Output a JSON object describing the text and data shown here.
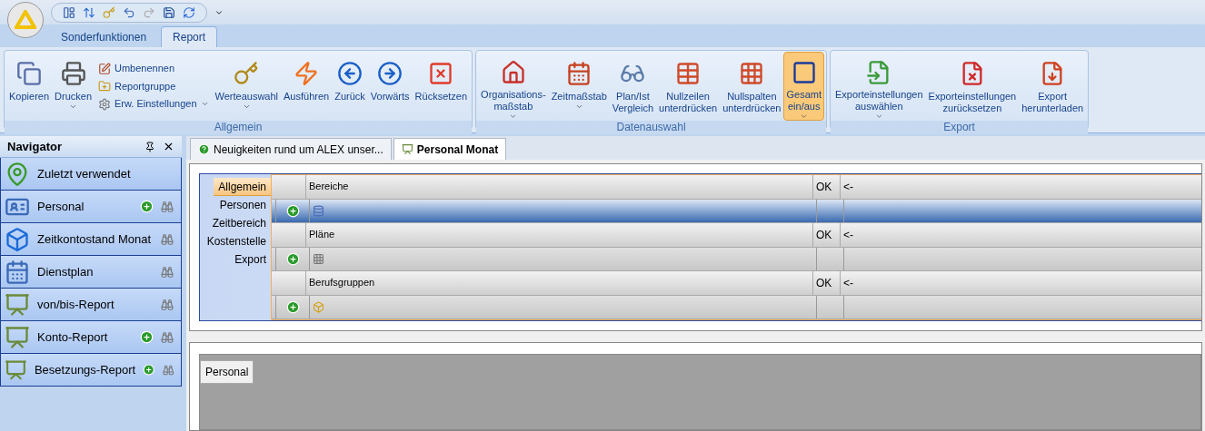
{
  "ribbon": {
    "tabs": [
      {
        "label": "Sonderfunktionen",
        "selected": false
      },
      {
        "label": "Report",
        "selected": true
      }
    ],
    "groups": [
      {
        "label": "Allgemein",
        "items": [
          {
            "kind": "large",
            "lines": [
              "Kopieren"
            ],
            "dropdown": false,
            "selected": false
          },
          {
            "kind": "large",
            "lines": [
              "Drucken"
            ],
            "dropdown": true,
            "selected": false
          },
          {
            "kind": "stack",
            "entries": [
              {
                "label": "Umbenennen",
                "dropdown": false
              },
              {
                "label": "Reportgruppe",
                "dropdown": false
              },
              {
                "label": "Erw. Einstellungen",
                "dropdown": true
              }
            ]
          },
          {
            "kind": "large",
            "lines": [
              "Werteauswahl"
            ],
            "dropdown": true,
            "selected": false
          },
          {
            "kind": "large",
            "lines": [
              "Ausführen"
            ],
            "dropdown": false,
            "selected": false
          },
          {
            "kind": "large",
            "lines": [
              "Zurück"
            ],
            "dropdown": false,
            "selected": false
          },
          {
            "kind": "large",
            "lines": [
              "Vorwärts"
            ],
            "dropdown": false,
            "selected": false
          },
          {
            "kind": "large",
            "lines": [
              "Rücksetzen"
            ],
            "dropdown": false,
            "selected": false
          }
        ]
      },
      {
        "label": "Datenauswahl",
        "items": [
          {
            "kind": "large",
            "lines": [
              "Organisations-",
              "maßstab"
            ],
            "dropdown": true,
            "selected": false
          },
          {
            "kind": "large",
            "lines": [
              "Zeitmaßstab"
            ],
            "dropdown": true,
            "selected": false
          },
          {
            "kind": "large",
            "lines": [
              "Plan/Ist",
              "Vergleich"
            ],
            "dropdown": false,
            "selected": false
          },
          {
            "kind": "large",
            "lines": [
              "Nullzeilen",
              "unterdrücken"
            ],
            "dropdown": false,
            "selected": false
          },
          {
            "kind": "large",
            "lines": [
              "Nullspalten",
              "unterdrücken"
            ],
            "dropdown": false,
            "selected": false
          },
          {
            "kind": "large",
            "lines": [
              "Gesamt",
              "ein/aus"
            ],
            "dropdown": true,
            "selected": true
          }
        ]
      },
      {
        "label": "Export",
        "items": [
          {
            "kind": "large",
            "lines": [
              "Exporteinstellungen",
              "auswählen"
            ],
            "dropdown": true,
            "selected": false
          },
          {
            "kind": "large",
            "lines": [
              "Exporteinstellungen",
              "zurücksetzen"
            ],
            "dropdown": false,
            "selected": false
          },
          {
            "kind": "large",
            "lines": [
              "Export",
              "herunterladen"
            ],
            "dropdown": false,
            "selected": false
          }
        ]
      }
    ]
  },
  "navigator": {
    "title": "Navigator",
    "items": [
      {
        "label": "Zuletzt verwendet",
        "add": false,
        "view": false
      },
      {
        "label": "Personal",
        "add": true,
        "view": true
      },
      {
        "label": "Zeitkontostand Monat",
        "add": false,
        "view": true
      },
      {
        "label": "Dienstplan",
        "add": false,
        "view": true
      },
      {
        "label": "von/bis-Report",
        "add": false,
        "view": true
      },
      {
        "label": "Konto-Report",
        "add": true,
        "view": true
      },
      {
        "label": "Besetzungs-Report",
        "add": true,
        "view": true
      }
    ]
  },
  "document_tabs": [
    {
      "label": "Neuigkeiten rund um ALEX unser...",
      "selected": false
    },
    {
      "label": "Personal Monat",
      "selected": true
    }
  ],
  "report_editor": {
    "side_tabs": [
      {
        "label": "Allgemein",
        "selected": true
      },
      {
        "label": "Personen",
        "selected": false
      },
      {
        "label": "Zeitbereich",
        "selected": false
      },
      {
        "label": "Kostenstelle",
        "selected": false
      },
      {
        "label": "Export",
        "selected": false
      }
    ],
    "sections": [
      {
        "title": "Bereiche",
        "status": "OK",
        "arrow": "<-",
        "selected": true
      },
      {
        "title": "Pläne",
        "status": "OK",
        "arrow": "<-",
        "selected": false
      },
      {
        "title": "Berufsgruppen",
        "status": "OK",
        "arrow": "<-",
        "selected": false
      }
    ]
  },
  "result_panel": {
    "tab": "Personal"
  }
}
